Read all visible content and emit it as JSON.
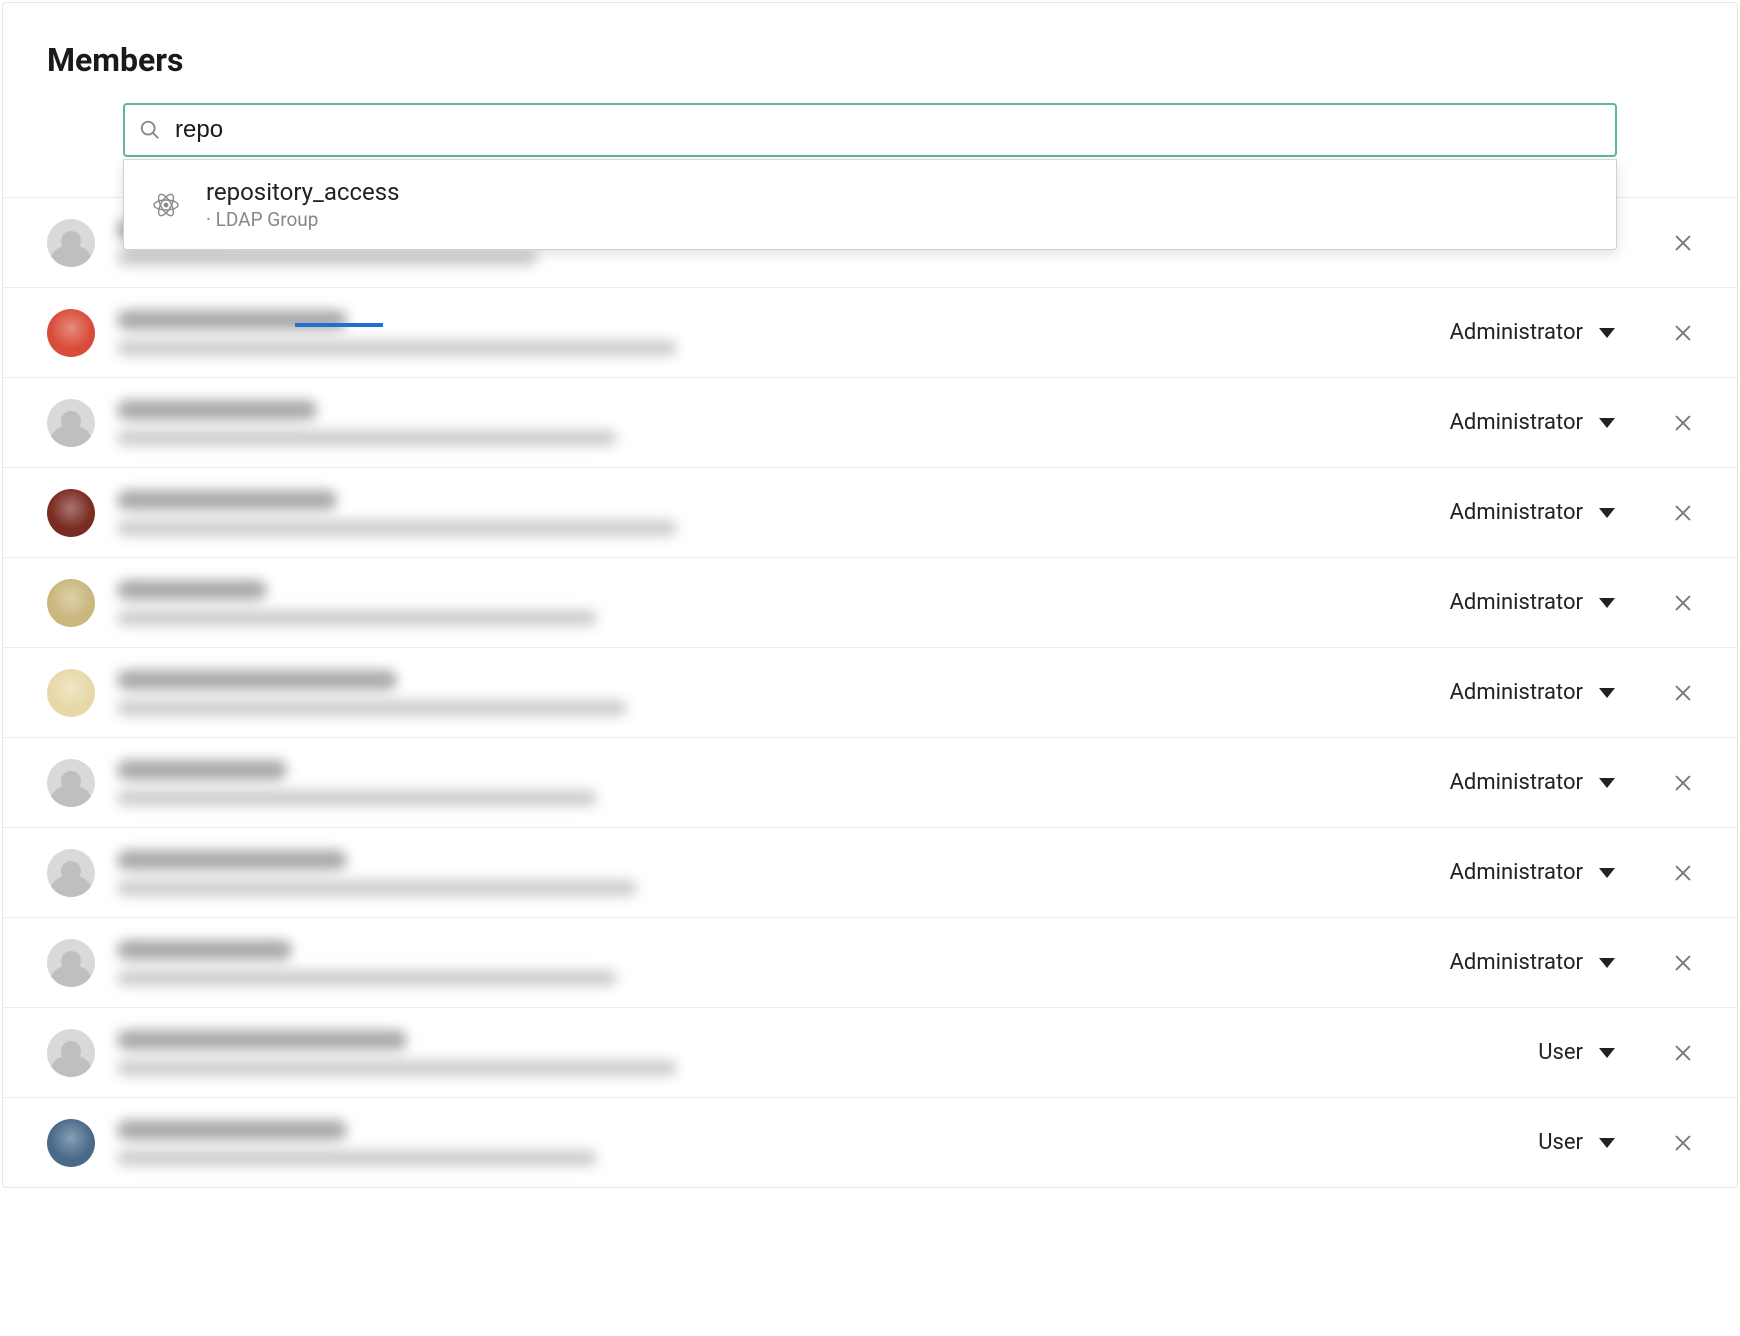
{
  "header": {
    "title": "Members"
  },
  "search": {
    "value": "repo",
    "suggestion": {
      "title": "repository_access",
      "subtitle": "· LDAP Group"
    }
  },
  "roles": {
    "user": "User",
    "administrator": "Administrator"
  },
  "members": [
    {
      "avatar": "silhouette",
      "color": "#d9d9d9",
      "nameW": 120,
      "subW": 420,
      "role": "user"
    },
    {
      "avatar": "photo",
      "color": "#d94c3a",
      "nameW": 230,
      "subW": 560,
      "role": "administrator"
    },
    {
      "avatar": "silhouette",
      "color": "#d9d9d9",
      "nameW": 200,
      "subW": 500,
      "role": "administrator"
    },
    {
      "avatar": "photo",
      "color": "#7a2c22",
      "nameW": 220,
      "subW": 560,
      "role": "administrator"
    },
    {
      "avatar": "photo",
      "color": "#c9b77e",
      "nameW": 150,
      "subW": 480,
      "role": "administrator"
    },
    {
      "avatar": "photo",
      "color": "#e8d8a8",
      "nameW": 280,
      "subW": 510,
      "role": "administrator"
    },
    {
      "avatar": "silhouette",
      "color": "#d9d9d9",
      "nameW": 170,
      "subW": 480,
      "role": "administrator"
    },
    {
      "avatar": "silhouette",
      "color": "#d9d9d9",
      "nameW": 230,
      "subW": 520,
      "role": "administrator"
    },
    {
      "avatar": "silhouette",
      "color": "#d9d9d9",
      "nameW": 175,
      "subW": 500,
      "role": "administrator"
    },
    {
      "avatar": "silhouette",
      "color": "#d9d9d9",
      "nameW": 290,
      "subW": 560,
      "role": "user"
    },
    {
      "avatar": "photo",
      "color": "#4a6a8a",
      "nameW": 230,
      "subW": 480,
      "role": "user"
    }
  ]
}
